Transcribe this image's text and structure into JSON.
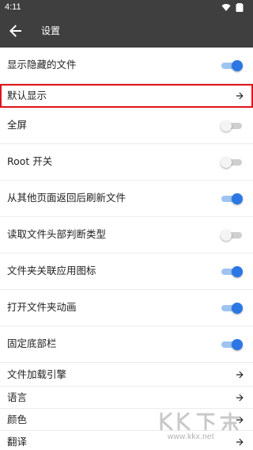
{
  "status_bar": {
    "time": "4:11",
    "icons": [
      "wifi-icon",
      "battery-icon"
    ]
  },
  "app_bar": {
    "title": "设置",
    "back_icon": "arrow-left-icon"
  },
  "colors": {
    "bar": "#3f3f3f",
    "accent": "#2b77e4",
    "highlight": "#e0141b"
  },
  "settings": [
    {
      "label": "显示隐藏的文件",
      "control": "toggle",
      "on": true
    },
    {
      "label": "默认显示",
      "control": "arrow",
      "highlighted": true
    },
    {
      "label": "全屏",
      "control": "toggle",
      "on": false
    },
    {
      "label": "Root 开关",
      "control": "toggle",
      "on": false
    },
    {
      "label": "从其他页面返回后刷新文件",
      "control": "toggle",
      "on": true
    },
    {
      "label": "读取文件头部判断类型",
      "control": "toggle",
      "on": false
    },
    {
      "label": "文件夹关联应用图标",
      "control": "toggle",
      "on": true
    },
    {
      "label": "打开文件夹动画",
      "control": "toggle",
      "on": true
    },
    {
      "label": "固定底部栏",
      "control": "toggle",
      "on": true
    },
    {
      "label": "文件加载引擎",
      "control": "arrow"
    },
    {
      "label": "语言",
      "control": "arrow"
    },
    {
      "label": "颜色",
      "control": "arrow"
    },
    {
      "label": "翻译",
      "control": "arrow"
    }
  ],
  "watermark": {
    "logo_text": "KK下载",
    "url": "www.kkx.net"
  }
}
